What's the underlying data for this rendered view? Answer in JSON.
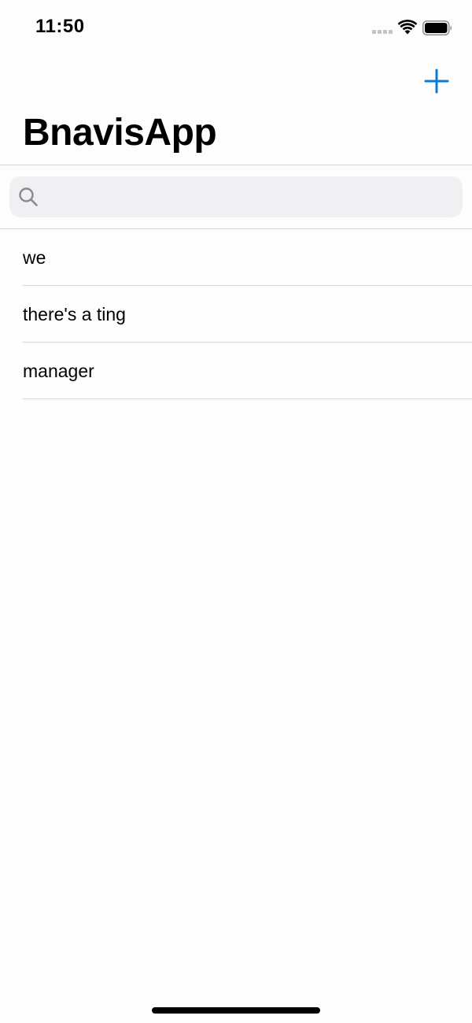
{
  "status_bar": {
    "time": "11:50"
  },
  "nav": {
    "title": "BnavisApp",
    "add_icon": "plus-icon",
    "accent_color": "#0a7ad9"
  },
  "search": {
    "placeholder": "",
    "value": "",
    "icon": "search-icon"
  },
  "list": {
    "items": [
      {
        "label": "we"
      },
      {
        "label": "there's a ting"
      },
      {
        "label": "manager"
      }
    ]
  }
}
